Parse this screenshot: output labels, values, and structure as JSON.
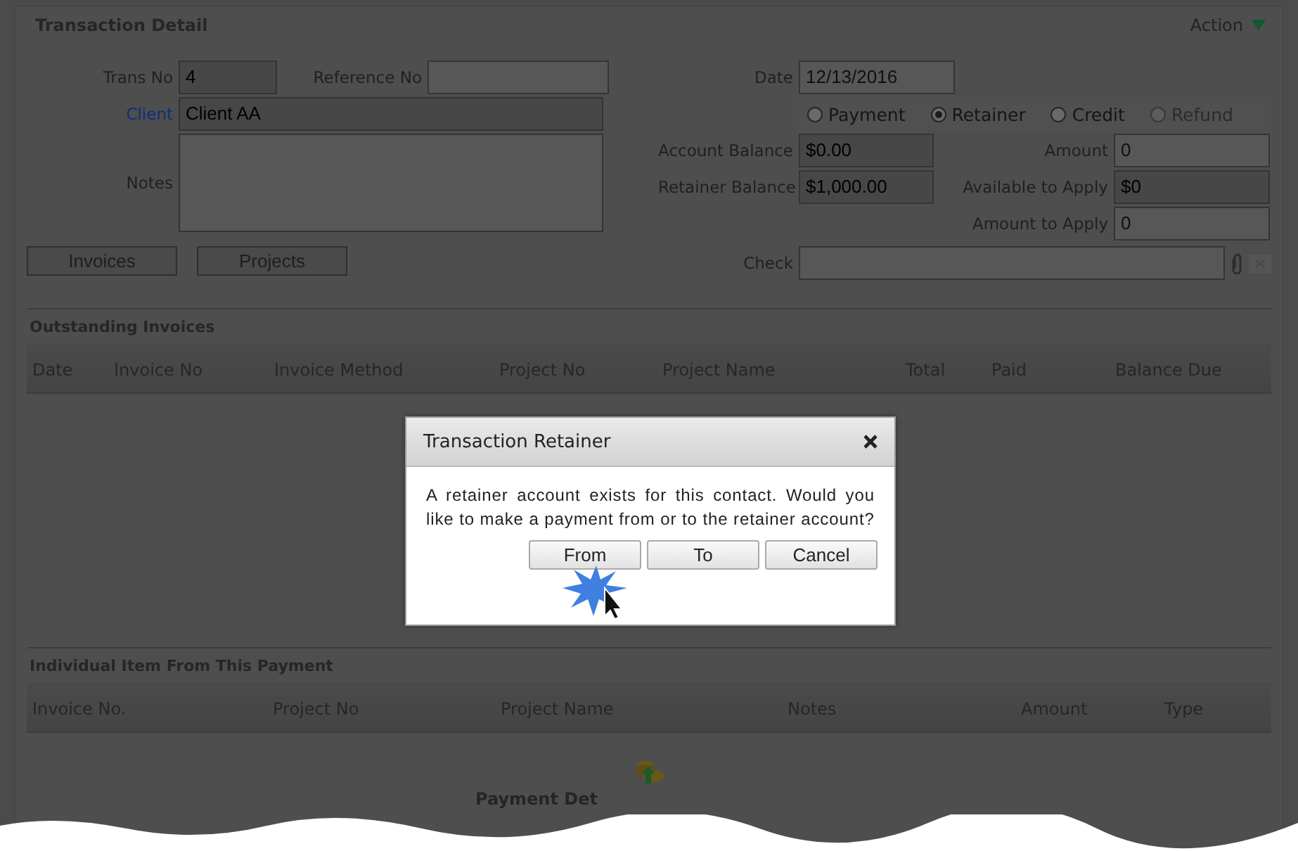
{
  "page": {
    "title": "Transaction Detail",
    "action_menu": "Action"
  },
  "trans_no": {
    "label": "Trans No",
    "value": "4",
    "readonly": true
  },
  "reference_no": {
    "label": "Reference No",
    "readonly": false
  },
  "client": {
    "label": "Client",
    "value": "Client AA",
    "readonly": true
  },
  "notes": {
    "label": "Notes"
  },
  "buttons": [
    "Invoices",
    "Projects"
  ],
  "date": {
    "label": "Date",
    "value": "12/13/2016",
    "readonly": false
  },
  "transaction_types": [
    {
      "label": "Payment",
      "selected": false,
      "disabled": false
    },
    {
      "label": "Retainer",
      "selected": true,
      "disabled": false
    },
    {
      "label": "Credit",
      "selected": false,
      "disabled": false
    },
    {
      "label": "Refund",
      "selected": false,
      "disabled": true
    }
  ],
  "balances": [
    {
      "label": "Account Balance",
      "value": "$0.00",
      "readonly": true
    },
    {
      "label": "Retainer Balance",
      "value": "$1,000.00",
      "readonly": true
    }
  ],
  "amounts": [
    {
      "label": "Amount",
      "value": "0",
      "readonly": false
    },
    {
      "label": "Available to Apply",
      "value": "$0",
      "readonly": true
    },
    {
      "label": "Amount to Apply",
      "value": "0",
      "readonly": false
    }
  ],
  "check": {
    "label": "Check"
  },
  "outstanding_invoices": {
    "title": "Outstanding Invoices",
    "columns": [
      "Date",
      "Invoice No",
      "Invoice Method",
      "Project No",
      "Project Name",
      "Total",
      "Paid",
      "Balance Due"
    ]
  },
  "payment_items": {
    "title": "Individual Item From This Payment",
    "columns": [
      "Invoice No.",
      "Project No",
      "Project Name",
      "Notes",
      "Amount",
      "Type"
    ]
  },
  "footer": {
    "label": "Payment Det"
  },
  "dialog": {
    "title": "Transaction Retainer",
    "message": "A retainer account exists for this contact. Would you like to make a payment from or to the retainer account?",
    "buttons": [
      "From",
      "To",
      "Cancel"
    ]
  }
}
